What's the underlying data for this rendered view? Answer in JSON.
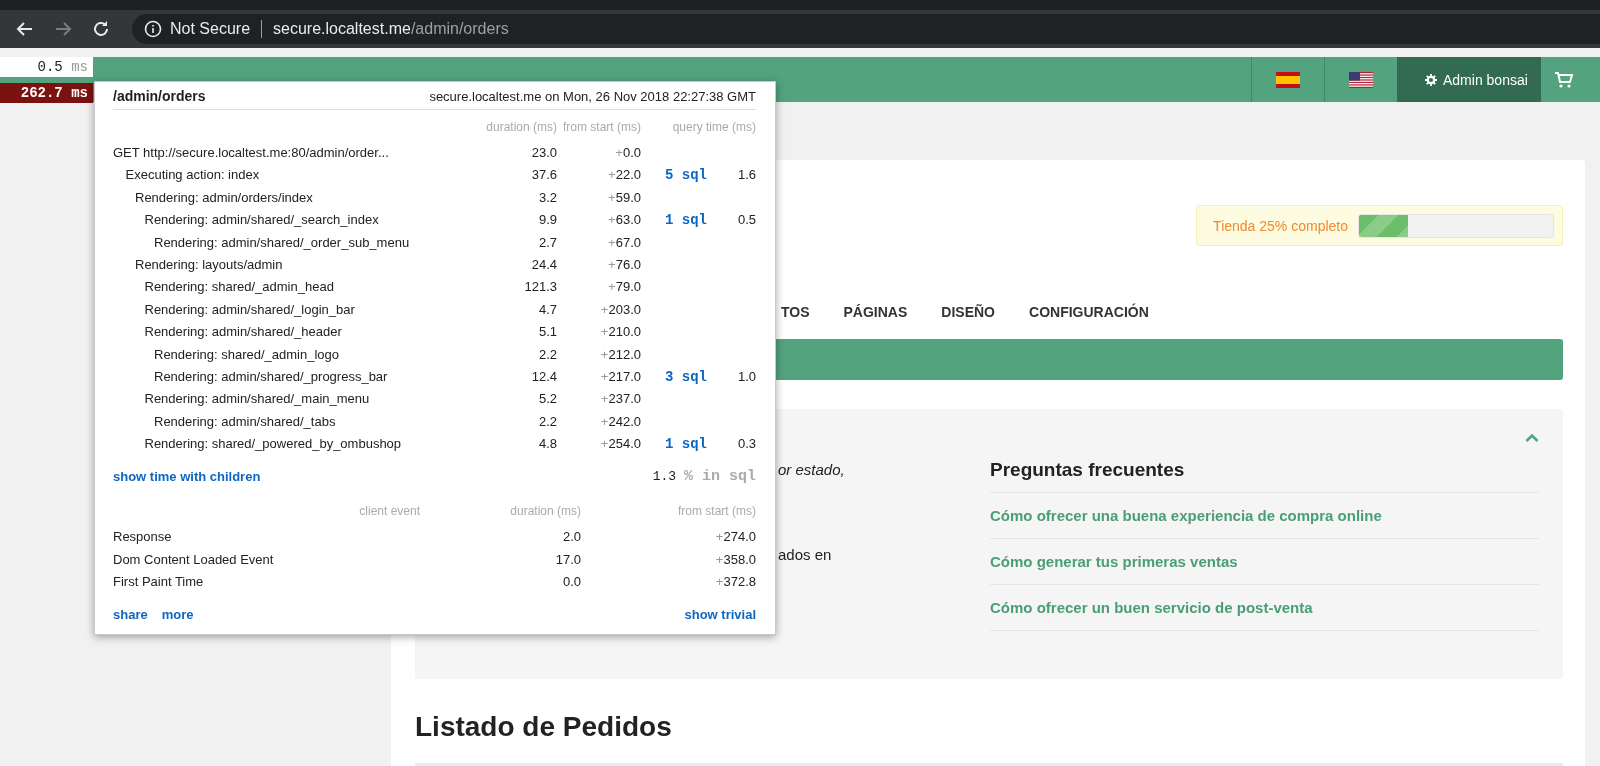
{
  "browser": {
    "security_label": "Not Secure",
    "url_host": "secure.localtest.me",
    "url_path": "/admin/orders"
  },
  "profiler_badges": [
    {
      "time": "0.5",
      "unit": "ms",
      "kind": "plain"
    },
    {
      "time": "262.7",
      "unit": "ms",
      "kind": "slow"
    }
  ],
  "nav": {
    "user": "Admin bonsai"
  },
  "profiler": {
    "title": "/admin/orders",
    "subtitle": "secure.localtest.me on Mon, 26 Nov 2018 22:27:38 GMT",
    "columns": [
      "duration (ms)",
      "from start (ms)",
      "query time (ms)"
    ],
    "timings": [
      {
        "label": "GET http://secure.localtest.me:80/admin/order...",
        "duration": "23.0",
        "from_start": "+0.0",
        "children": [
          {
            "label": "Executing action: index",
            "duration": "37.6",
            "from_start": "+22.0",
            "sql": "5 sql",
            "query_ms": "1.6",
            "children": [
              {
                "label": "Rendering: admin/orders/index",
                "duration": "3.2",
                "from_start": "+59.0",
                "children": [
                  {
                    "label": "Rendering: admin/shared/_search_index",
                    "duration": "9.9",
                    "from_start": "+63.0",
                    "sql": "1 sql",
                    "query_ms": "0.5",
                    "children": [
                      {
                        "label": "Rendering: admin/shared/_order_sub_menu",
                        "duration": "2.7",
                        "from_start": "+67.0"
                      }
                    ]
                  }
                ]
              },
              {
                "label": "Rendering: layouts/admin",
                "duration": "24.4",
                "from_start": "+76.0",
                "children": [
                  {
                    "label": "Rendering: shared/_admin_head",
                    "duration": "121.3",
                    "from_start": "+79.0"
                  },
                  {
                    "label": "Rendering: admin/shared/_login_bar",
                    "duration": "4.7",
                    "from_start": "+203.0"
                  },
                  {
                    "label": "Rendering: admin/shared/_header",
                    "duration": "5.1",
                    "from_start": "+210.0",
                    "children": [
                      {
                        "label": "Rendering: shared/_admin_logo",
                        "duration": "2.2",
                        "from_start": "+212.0"
                      },
                      {
                        "label": "Rendering: admin/shared/_progress_bar",
                        "duration": "12.4",
                        "from_start": "+217.0",
                        "sql": "3 sql",
                        "query_ms": "1.0"
                      }
                    ]
                  },
                  {
                    "label": "Rendering: admin/shared/_main_menu",
                    "duration": "5.2",
                    "from_start": "+237.0",
                    "children": [
                      {
                        "label": "Rendering: admin/shared/_tabs",
                        "duration": "2.2",
                        "from_start": "+242.0"
                      }
                    ]
                  },
                  {
                    "label": "Rendering: shared/_powered_by_ombushop",
                    "duration": "4.8",
                    "from_start": "+254.0",
                    "sql": "1 sql",
                    "query_ms": "0.3"
                  }
                ]
              }
            ]
          }
        ]
      }
    ],
    "toggle_link": "show time with children",
    "sql_percent": "1.3",
    "sql_label": "% in sql",
    "client_columns": [
      "client event",
      "duration (ms)",
      "from start (ms)"
    ],
    "client_events": [
      {
        "name": "Response",
        "duration": "2.0",
        "from_start": "+274.0"
      },
      {
        "name": "Dom Content Loaded Event",
        "duration": "17.0",
        "from_start": "+358.0"
      },
      {
        "name": "First Paint Time",
        "duration": "0.0",
        "from_start": "+372.8"
      }
    ],
    "links": [
      "share",
      "more"
    ],
    "trivial_link": "show trivial"
  },
  "store_progress": {
    "label": "Tienda 25% completo",
    "level": 0.25
  },
  "tabs": [
    {
      "label": "TOS"
    },
    {
      "label": "PÁGINAS"
    },
    {
      "label": "DISEÑO"
    },
    {
      "label": "CONFIGURACIÓN"
    }
  ],
  "help": {
    "intro_fragments": [
      "or estado,",
      "ados en"
    ],
    "faq_title": "Preguntas frecuentes",
    "faq_links": [
      "Cómo ofrecer una buena experiencia de compra online",
      "Cómo generar tus primeras ventas",
      "Cómo ofrecer un buen servicio de post-venta"
    ]
  },
  "orders_title": "Listado de Pedidos"
}
